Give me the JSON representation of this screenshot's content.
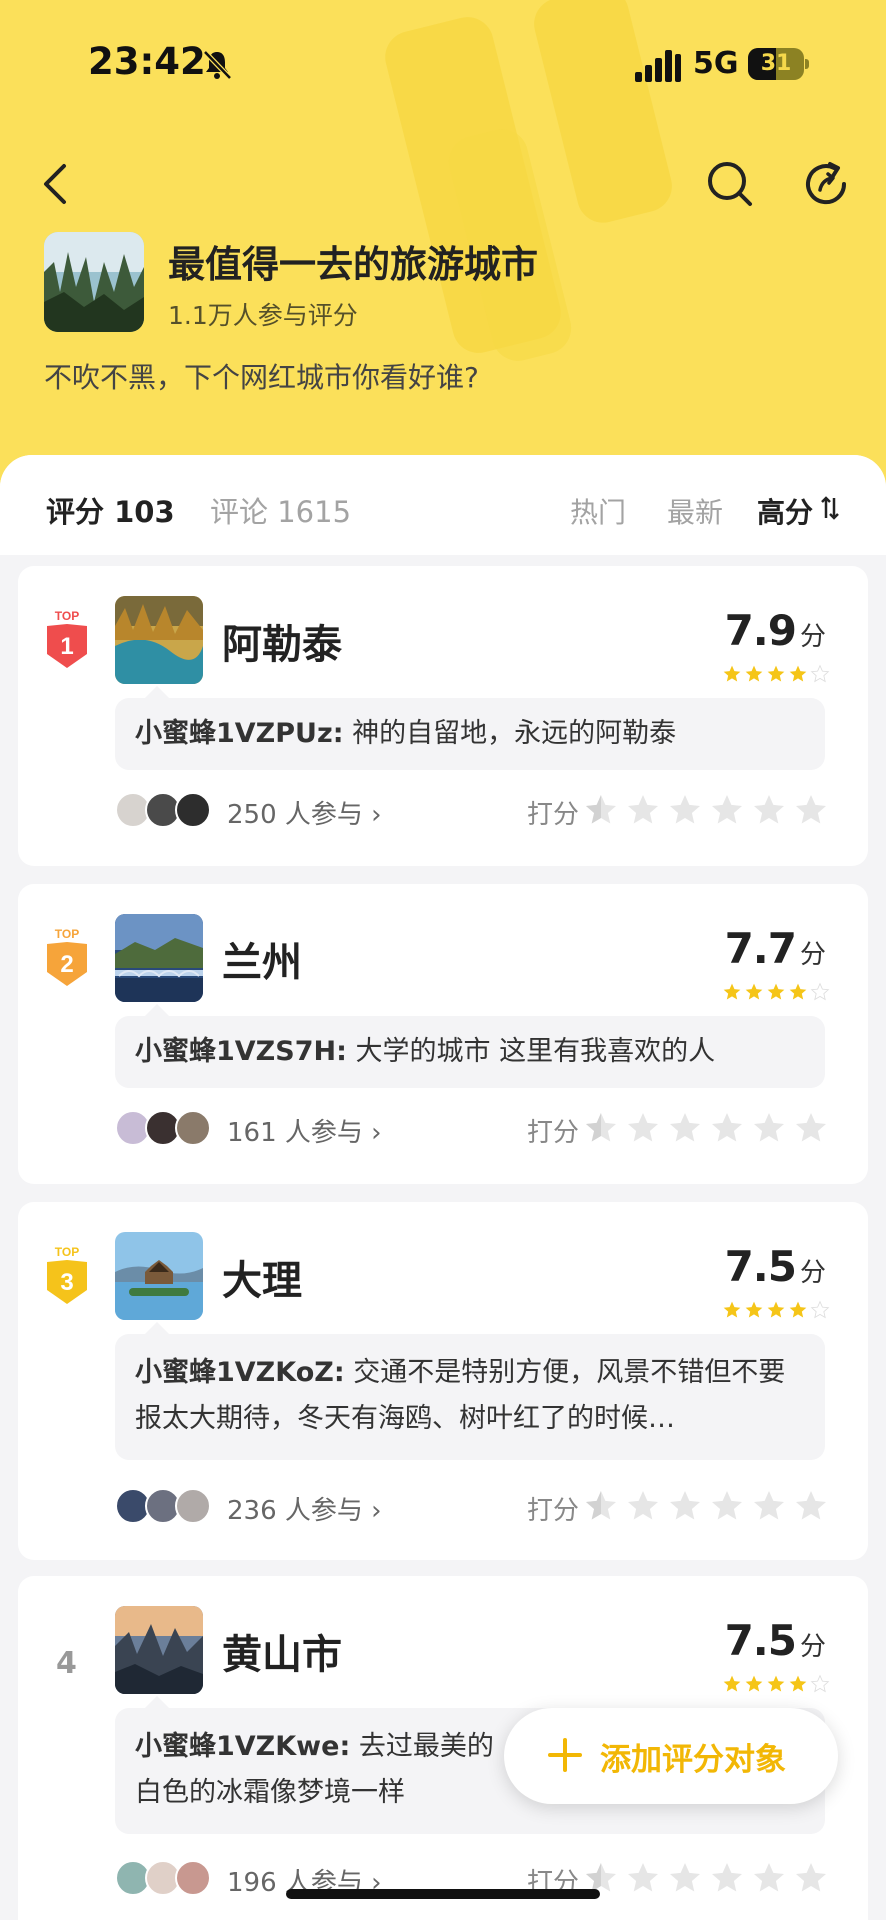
{
  "status_bar": {
    "time": "23:42",
    "network": "5G",
    "battery": "31"
  },
  "header": {
    "title": "最值得一去的旅游城市",
    "participants": "1.1万人参与评分",
    "description": "不吹不黑，下个网红城市你看好谁?"
  },
  "tabs": {
    "rating": "评分 103",
    "comments": "评论 1615",
    "sort_hot": "热门",
    "sort_new": "最新",
    "sort_high": "高分"
  },
  "items": [
    {
      "rank_badge": "TOP",
      "rank": "1",
      "name": "阿勒泰",
      "score": "7.9",
      "score_unit": "分",
      "stars": 4,
      "comment_user": "小蜜蜂1VZPUz:",
      "comment": "神的自留地，永远的阿勒泰",
      "participants": "250 人参与 ›",
      "rate_label": "打分"
    },
    {
      "rank_badge": "TOP",
      "rank": "2",
      "name": "兰州",
      "score": "7.7",
      "score_unit": "分",
      "stars": 4,
      "comment_user": "小蜜蜂1VZS7H:",
      "comment": "大学的城市 这里有我喜欢的人",
      "participants": "161 人参与 ›",
      "rate_label": "打分"
    },
    {
      "rank_badge": "TOP",
      "rank": "3",
      "name": "大理",
      "score": "7.5",
      "score_unit": "分",
      "stars": 4,
      "comment_user": "小蜜蜂1VZKoZ:",
      "comment": "交通不是特别方便，风景不错但不要报太大期待，冬天有海鸥、树叶红了的时候…",
      "participants": "236 人参与 ›",
      "rate_label": "打分"
    },
    {
      "rank": "4",
      "name": "黄山市",
      "score": "7.5",
      "score_unit": "分",
      "stars": 4,
      "comment_user": "小蜜蜂1VZKwe:",
      "comment": "去过最美的…白色的冰霜像梦境一样",
      "comment_line1": "去过最美的",
      "comment_line2": "白色的冰霜像梦境一样",
      "participants": "196 人参与 ›",
      "rate_label": "打分"
    }
  ],
  "fab": {
    "label": "添加评分对象"
  },
  "colors": {
    "header_bg": "#fbe05a",
    "accent": "#f2b705",
    "top1": "#ef4d4d",
    "top2": "#f6a43a",
    "top3": "#f5c31b",
    "star": "#f5c518"
  }
}
